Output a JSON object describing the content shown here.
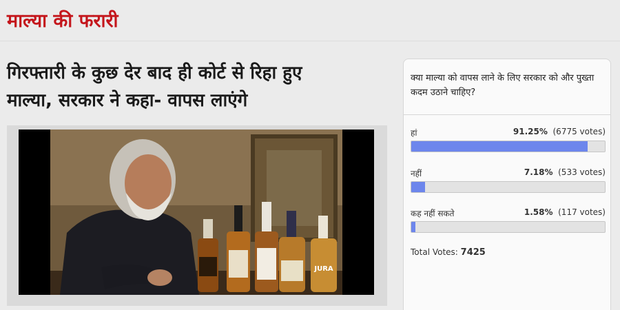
{
  "section": {
    "title": "माल्या की फरारी"
  },
  "article": {
    "headline_line1": "गिरफ्तारी के कुछ देर बाद ही कोर्ट से रिहा हुए",
    "headline_line2": "माल्या, सरकार ने कहा- वापस लाएंगे",
    "photo_bottle_label": "JURA"
  },
  "poll": {
    "question": "क्या माल्या को वापस लाने के लिए सरकार को और पुख्ता कदम उठाने चाहिए?",
    "options": [
      {
        "label": "हां",
        "percent": "91.25%",
        "votes": "(6775 votes)",
        "fill": 91.25
      },
      {
        "label": "नहीं",
        "percent": "7.18%",
        "votes": "(533 votes)",
        "fill": 7.18
      },
      {
        "label": "कह नहीं सकते",
        "percent": "1.58%",
        "votes": "(117 votes)",
        "fill": 1.58
      }
    ],
    "total_label": "Total Votes:",
    "total_value": "7425"
  },
  "colors": {
    "accent": "#c4161c",
    "bar_fill": "#6d86ec",
    "bar_track": "#e3e3e3"
  }
}
